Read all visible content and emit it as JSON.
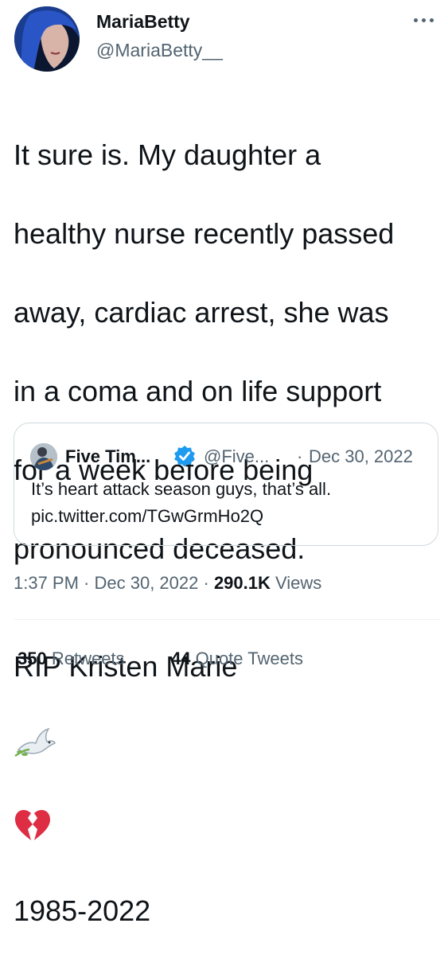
{
  "tweet": {
    "author_name": "MariaBetty",
    "author_handle": "@MariaBetty__",
    "text_line1": "It sure is. My daughter a",
    "text_line2": "healthy nurse recently passed",
    "text_line3": "away, cardiac arrest, she was",
    "text_line4": "in a coma and on life support",
    "text_line5": "for a week before being",
    "text_line6": "pronounced deceased.",
    "text_line7": "RIP Kristen Marie",
    "text_line8": "1985-2022",
    "emojis": [
      "dove-emoji",
      "broken-heart-emoji"
    ]
  },
  "quote": {
    "author_name": "Five Tim...",
    "author_handle": "@Five...",
    "separator": "·",
    "date": "Dec 30, 2022",
    "text_line1": "It’s heart attack season guys, that’s all.",
    "text_line2": "pic.twitter.com/TGwGrmHo2Q"
  },
  "meta": {
    "time": "1:37 PM",
    "sep1": " · ",
    "date": "Dec 30, 2022",
    "sep2": " · ",
    "views_count": "290.1K",
    "views_label": " Views"
  },
  "stats": {
    "retweets_count": "350",
    "retweets_label": " Retweets",
    "quotes_count": "44",
    "quotes_label": " Quote Tweets"
  },
  "colors": {
    "text": "#0f1419",
    "secondary": "#536471",
    "border": "#cfd9de",
    "verified": "#1d9bf0",
    "broken_heart": "#dd2e44"
  }
}
